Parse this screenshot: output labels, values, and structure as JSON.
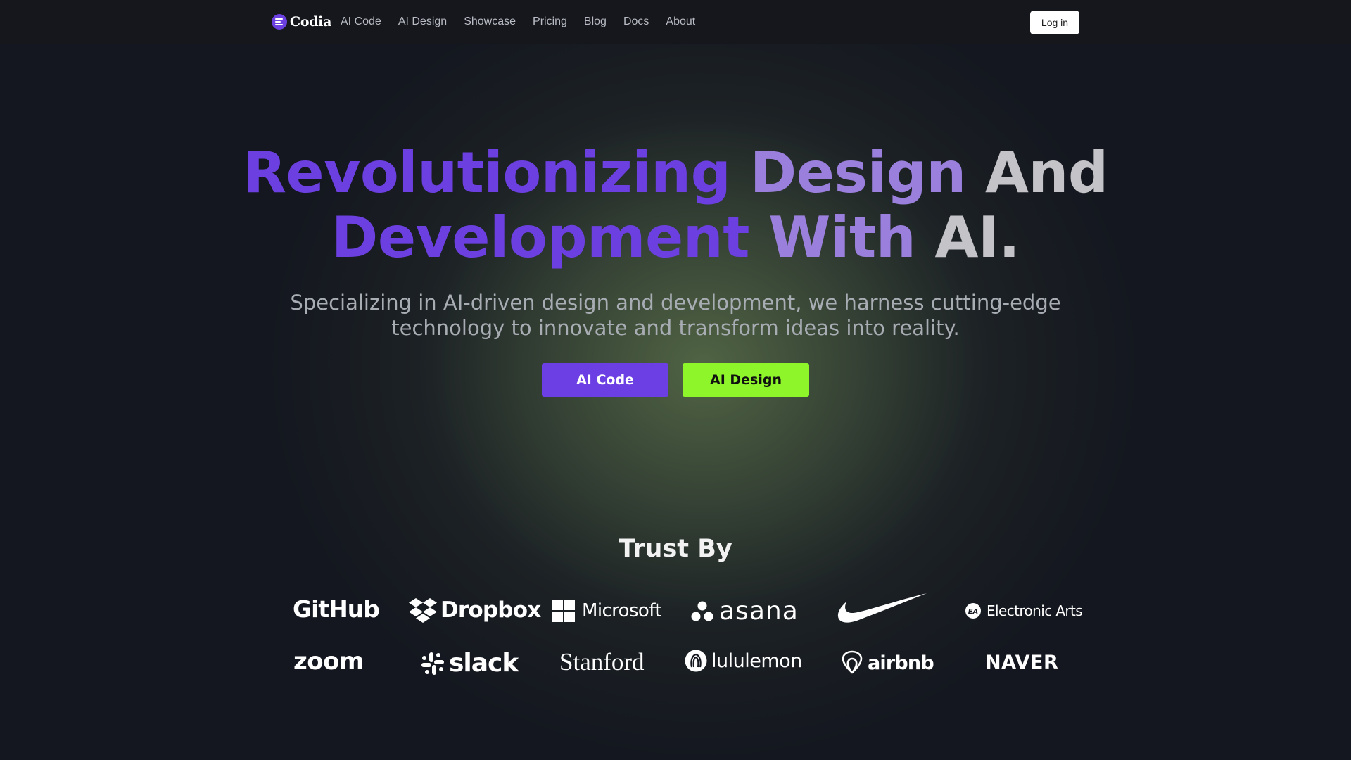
{
  "nav": {
    "brand": "Codia",
    "links": [
      "AI Code",
      "AI Design",
      "Showcase",
      "Pricing",
      "Blog",
      "Docs",
      "About"
    ],
    "login_label": "Log in"
  },
  "hero": {
    "title_words": [
      "Revolutionizing",
      "Design",
      "And",
      "Development",
      "With",
      "AI."
    ],
    "subtitle_line1": "Specializing in AI-driven design and development, we harness cutting-edge",
    "subtitle_line2": "technology to innovate and transform ideas into reality.",
    "cta_primary": "AI Code",
    "cta_secondary": "AI Design"
  },
  "trust": {
    "title": "Trust By",
    "logos": [
      "GitHub",
      "Dropbox",
      "Microsoft",
      "asana",
      "Nike",
      "Electronic Arts",
      "zoom",
      "slack",
      "Stanford",
      "lululemon",
      "airbnb",
      "NAVER"
    ]
  },
  "colors": {
    "brand_violet": "#6c40e0",
    "accent_lime": "#8ef52a",
    "background": "#14171f",
    "glow_green": "#546846"
  },
  "icons": [
    "codia-logo-icon",
    "dropbox-icon",
    "microsoft-icon",
    "asana-icon",
    "nike-swoosh-icon",
    "ea-icon",
    "slack-icon",
    "lululemon-icon",
    "airbnb-icon"
  ]
}
